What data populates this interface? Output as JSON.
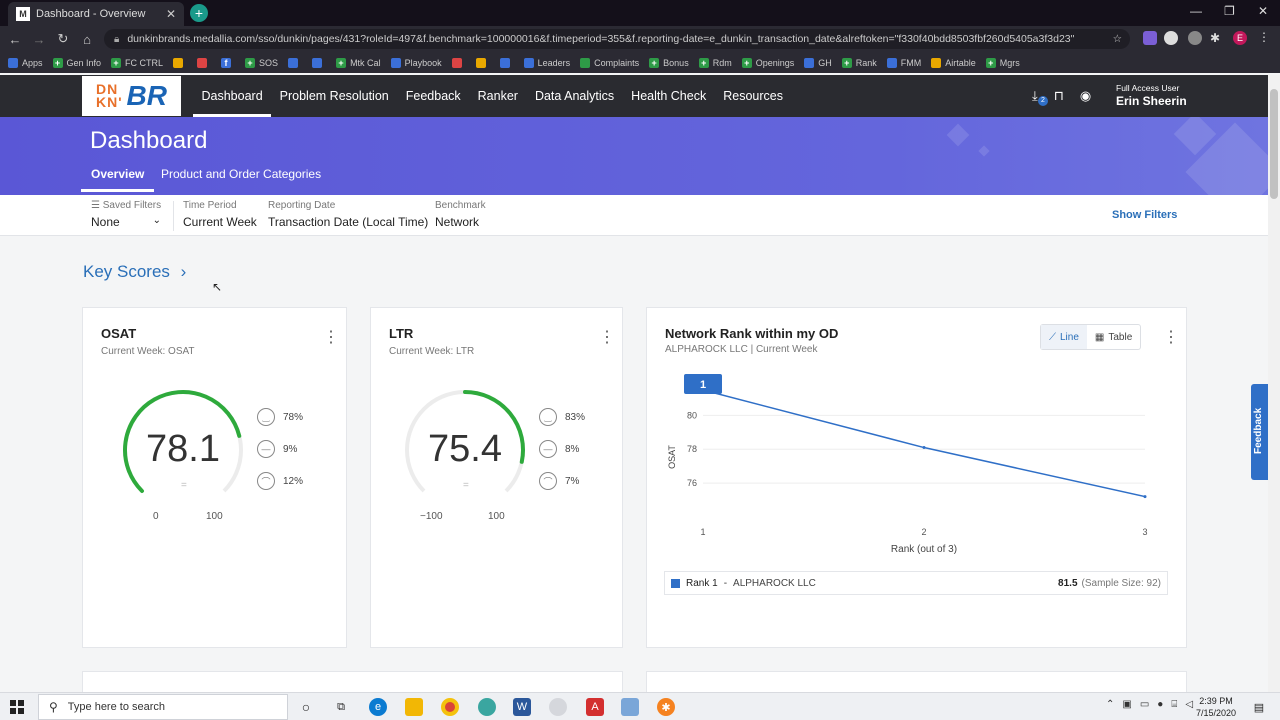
{
  "browser": {
    "tab_title": "Dashboard - Overview",
    "tab_favicon": "M",
    "url": "dunkinbrands.medallia.com/sso/dunkin/pages/431?roleId=497&f.benchmark=100000016&f.timeperiod=355&f.reporting-date=e_dunkin_transaction_date&alreftoken=\"f330f40bdd8503fbf260d5405a3f3d23\"",
    "profile_initial": "E",
    "bookmarks": [
      "Apps",
      "Gen Info",
      "FC CTRL",
      "SOS",
      "Mtk Cal",
      "Playbook",
      "Leaders",
      "Complaints",
      "Bonus",
      "Rdm",
      "Openings",
      "GH",
      "Rank",
      "FMM",
      "Airtable",
      "Mgrs"
    ]
  },
  "header": {
    "logo_top": "DN",
    "logo_bottom": "KN'",
    "logo_br": "BR",
    "nav": [
      "Dashboard",
      "Problem Resolution",
      "Feedback",
      "Ranker",
      "Data Analytics",
      "Health Check",
      "Resources"
    ],
    "download_badge": "2",
    "user_role": "Full Access User",
    "user_name": "Erin Sheerin"
  },
  "banner": {
    "title": "Dashboard",
    "tabs": [
      "Overview",
      "Product and Order Categories"
    ]
  },
  "filters": {
    "saved_label": "Saved Filters",
    "saved_value": "None",
    "period_label": "Time Period",
    "period_value": "Current Week",
    "reporting_label": "Reporting Date",
    "reporting_value": "Transaction Date (Local Time)",
    "benchmark_label": "Benchmark",
    "benchmark_value": "Network",
    "show_filters": "Show Filters"
  },
  "key_scores": {
    "title": "Key Scores",
    "chevron": "›"
  },
  "osat": {
    "title": "OSAT",
    "subtitle": "Current Week: OSAT",
    "value": "78.1",
    "score": 78.1,
    "min": "0",
    "max": "100",
    "equals": "=",
    "pct_positive": "78%",
    "pct_neutral": "9%",
    "pct_negative": "12%"
  },
  "ltr": {
    "title": "LTR",
    "subtitle": "Current Week: LTR",
    "value": "75.4",
    "score": 75.4,
    "min": "−100",
    "max": "100",
    "equals": "=",
    "pct_positive": "83%",
    "pct_neutral": "8%",
    "pct_negative": "7%"
  },
  "rank_card": {
    "title": "Network Rank within my OD",
    "subtitle": "ALPHAROCK LLC | Current Week",
    "toggle_line": "Line",
    "toggle_table": "Table",
    "legend_rank": "Rank 1",
    "legend_dash": "-",
    "legend_name": "ALPHAROCK LLC",
    "legend_value": "81.5",
    "legend_sample": "(Sample Size: 92)"
  },
  "chart_data": {
    "type": "line",
    "x": [
      1,
      2,
      3
    ],
    "x_tick_labels": [
      "1",
      "2",
      "3"
    ],
    "y_tick_labels": [
      "76",
      "78",
      "80"
    ],
    "xlabel": "Rank (out of 3)",
    "ylabel": "OSAT",
    "ylim": [
      75,
      81.5
    ],
    "series": [
      {
        "name": "Rank 1",
        "values": [
          81.5,
          78.1,
          75.2
        ]
      }
    ],
    "highlight_label": "1",
    "color": "#2f6fc7"
  },
  "feedback_tab": "Feedback",
  "taskbar": {
    "search_placeholder": "Type here to search",
    "time": "2:39 PM",
    "date": "7/15/2020"
  },
  "colors": {
    "banner": "#5a57d6",
    "nav": "#2a2b30",
    "gauge": "#2eaa3c",
    "link": "#2a6fb8"
  }
}
